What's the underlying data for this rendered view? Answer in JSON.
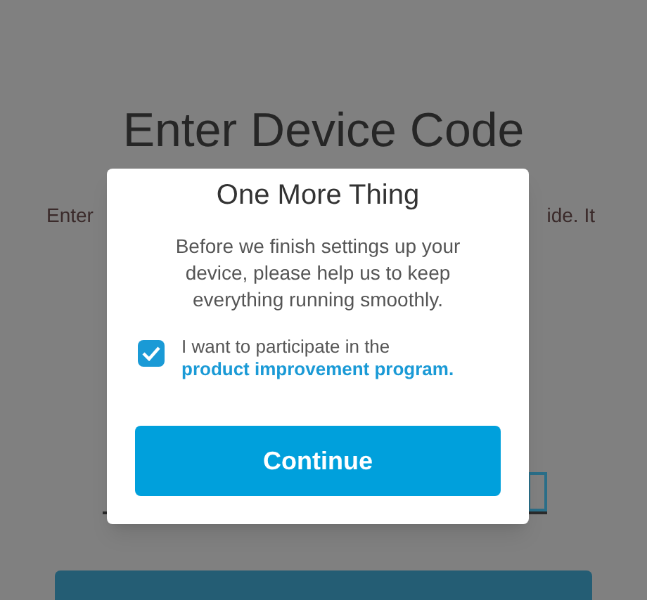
{
  "page": {
    "title": "Enter Device Code",
    "text_left": "Enter",
    "text_right": "ide. It"
  },
  "dialog": {
    "title": "One More Thing",
    "message": "Before we finish settings up your device, please help us to keep everything running smoothly.",
    "consent": {
      "checked": true,
      "label": "I want to participate in the",
      "link": "product improvement program."
    },
    "button": "Continue"
  }
}
